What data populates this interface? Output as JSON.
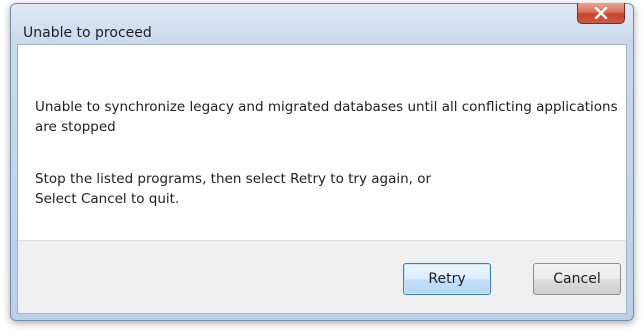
{
  "window": {
    "title": "Unable to proceed"
  },
  "message": {
    "line1": "Unable to synchronize legacy and migrated databases until all conflicting applications are stopped",
    "line2_a": "Stop the listed programs, then select Retry to try again, or",
    "line2_b": "Select Cancel to quit."
  },
  "buttons": {
    "retry_label": "Retry",
    "cancel_label": "Cancel"
  },
  "icons": {
    "close": "close-icon"
  },
  "colors": {
    "close_button": "#c4432b",
    "default_button_border": "#3c7fb1",
    "title_bar": "#c9d9ec"
  }
}
